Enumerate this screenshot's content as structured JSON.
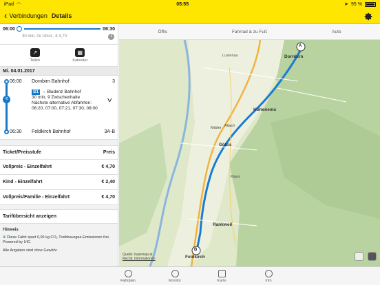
{
  "status_bar": {
    "carrier": "iPad",
    "time": "05:55",
    "battery": "95 %"
  },
  "nav": {
    "back_label": "Verbindungen",
    "title": "Details"
  },
  "summary": {
    "dep": "06:00",
    "arr": "06:30",
    "info": "30 min, 0x Umst., € 4,70"
  },
  "actions": [
    {
      "label": "Teilen"
    },
    {
      "label": "Kalender"
    }
  ],
  "date": "Mi. 04.01.2017",
  "journey": {
    "from": {
      "time": "06:00",
      "name": "Dornbirn Bahnhof",
      "platform": "3"
    },
    "line": "S1",
    "direction": "→ Bludenz Bahnhof",
    "duration": "30 min, 9 Zwischenhalte",
    "alt_label": "Nächste alternative Abfahrten:",
    "alt_times": "06:20, 07:00, 07:21, 07:30, 08:00",
    "to": {
      "time": "06:30",
      "name": "Feldkirch Bahnhof",
      "platform": "3A-B"
    }
  },
  "prices": {
    "header_left": "Ticket/Preisstufe",
    "header_right": "Preis",
    "rows": [
      {
        "label": "Vollpreis - Einzelfahrt",
        "price": "€ 4,70"
      },
      {
        "label": "Kind - Einzelfahrt",
        "price": "€ 2,40"
      },
      {
        "label": "Vollpreis/Familie - Einzelfahrt",
        "price": "€ 4,70"
      }
    ]
  },
  "tarif_link": "Tarifübersicht anzeigen",
  "hint": {
    "title": "Hinweis",
    "text": "Diese Fahrt spart 0,06 kg CO₂ Treibhausgas-Emissionen frei. Powered by UIC.",
    "all_prices": "Alle Angaben sind ohne Gewähr"
  },
  "mode_tabs": [
    "Öffis",
    "Fahrrad & zu Fuß",
    "Auto"
  ],
  "map": {
    "labels": {
      "dornbirn": "Dornbirn",
      "hohenems": "Hohenems",
      "altach": "Altach",
      "goetzis": "Götzis",
      "klaus": "Klaus",
      "rankweil": "Rankweil",
      "feldkirch": "Feldkirch",
      "lustenau": "Lustenau",
      "maeder": "Mäder"
    },
    "marker_a": "A",
    "marker_b": "B",
    "credit_source": "Quelle: basemap.at",
    "credit_legal": "Rechtl. Informationen"
  },
  "tab_bar": [
    "Fahrplan",
    "Monitor",
    "Karte",
    "Info"
  ]
}
